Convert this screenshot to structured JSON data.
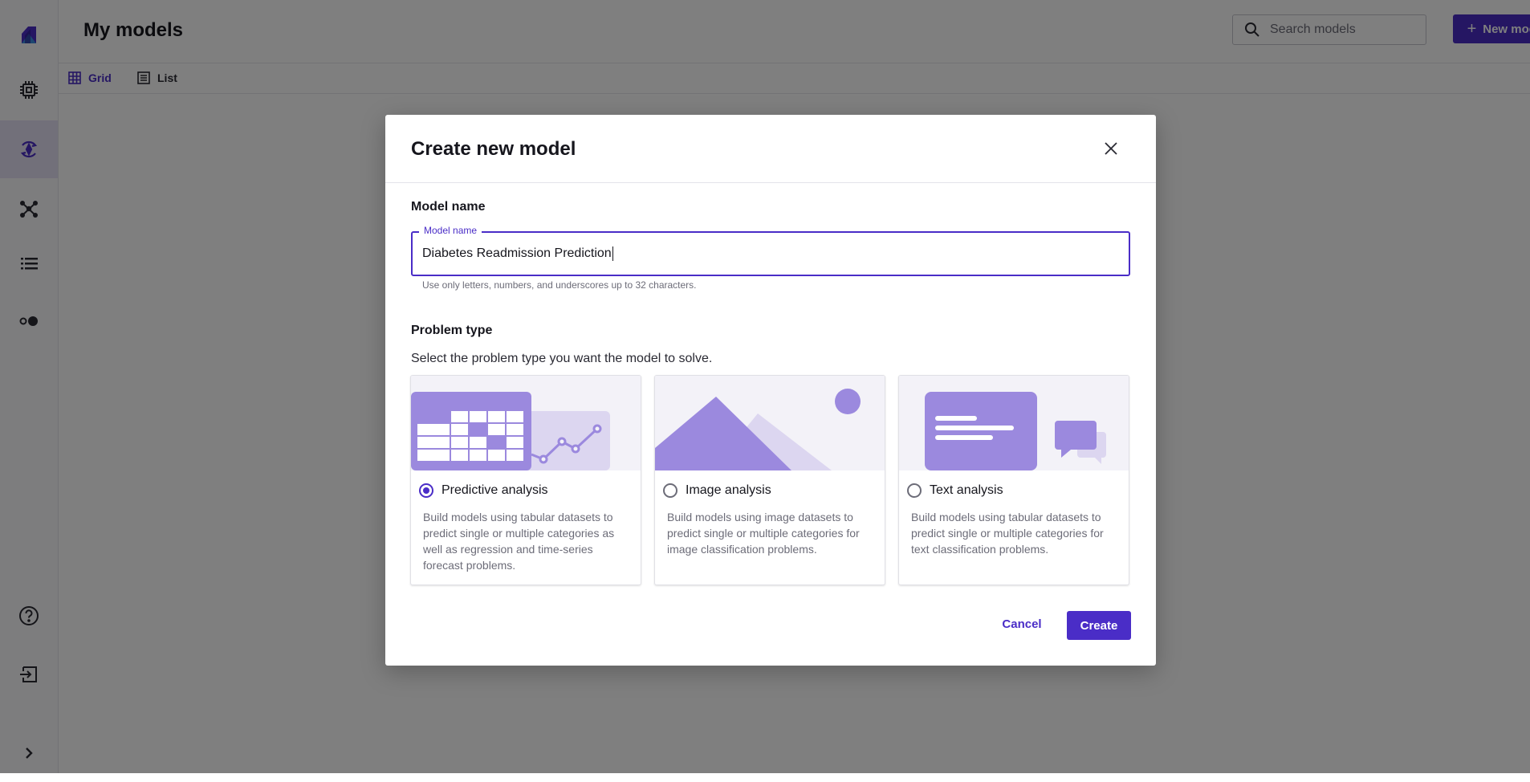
{
  "app": {
    "page_title": "My models",
    "search": {
      "placeholder": "Search models"
    },
    "new_model_label": "New model",
    "views": {
      "grid_label": "Grid",
      "list_label": "List",
      "selected": "Grid"
    },
    "sidebar": {
      "items": [
        {
          "name": "logo-icon"
        },
        {
          "name": "chip-icon"
        },
        {
          "name": "model-icon",
          "active": true
        },
        {
          "name": "network-icon"
        },
        {
          "name": "list-icon"
        },
        {
          "name": "toggle-icon"
        },
        {
          "name": "help-icon"
        },
        {
          "name": "exit-icon"
        },
        {
          "name": "chevron-right-icon"
        }
      ]
    }
  },
  "dialog": {
    "title": "Create new model",
    "model_name_section": "Model name",
    "model_name_field": {
      "label": "Model name",
      "value": "Diabetes Readmission Prediction",
      "hint": "Use only letters, numbers, and underscores up to 32 characters."
    },
    "problem_type_section": "Problem type",
    "problem_type_description": "Select the problem type you want the model to solve.",
    "options": [
      {
        "label": "Predictive analysis",
        "description": "Build models using tabular datasets to predict single or multiple categories as well as regression and time-series forecast problems.",
        "selected": true
      },
      {
        "label": "Image analysis",
        "description": "Build models using image datasets to predict single or multiple categories for image classification problems.",
        "selected": false
      },
      {
        "label": "Text analysis",
        "description": "Build models using tabular datasets to predict single or multiple categories for text classification problems.",
        "selected": false
      }
    ],
    "cancel_label": "Cancel",
    "create_label": "Create"
  },
  "colors": {
    "accent": "#4a2dc7",
    "illustration": "#9b89de",
    "illustration_light": "#dcd6f0",
    "overlay": "rgba(0,0,0,0.5)"
  }
}
